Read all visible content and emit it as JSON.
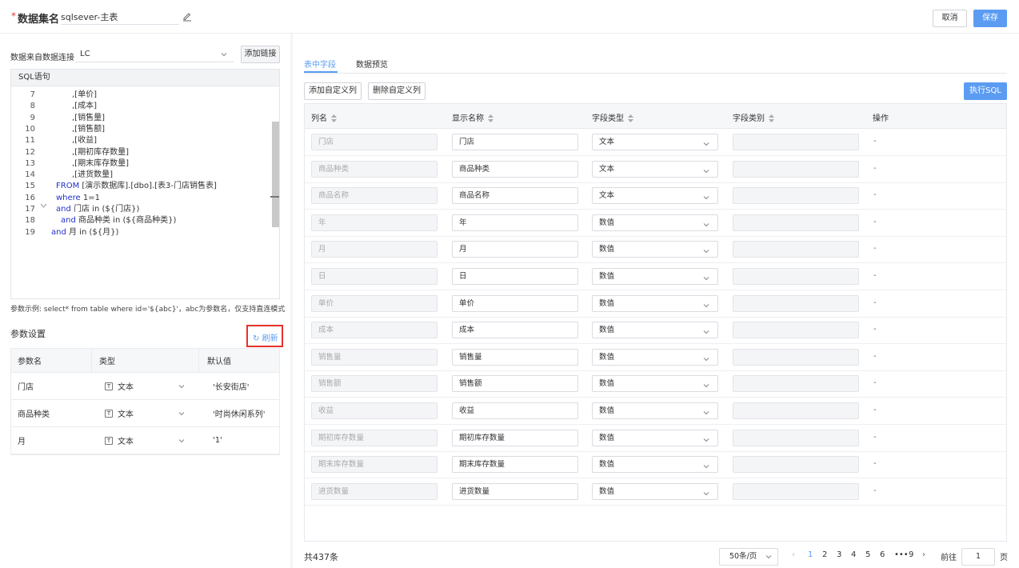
{
  "header": {
    "required_mark": "*",
    "title": "数据集名",
    "dataset_name": "sqlsever-主表",
    "cancel": "取消",
    "save": "保存"
  },
  "left": {
    "source_label": "数据来自数据连接",
    "source_value": "LC",
    "add_link": "添加链接",
    "sql_title": "SQL语句",
    "sql_lines": [
      {
        "n": "7",
        "t": ",[单价]"
      },
      {
        "n": "8",
        "t": ",[成本]"
      },
      {
        "n": "9",
        "t": ",[销售量]"
      },
      {
        "n": "10",
        "t": ",[销售额]"
      },
      {
        "n": "11",
        "t": ",[收益]"
      },
      {
        "n": "12",
        "t": ",[期初库存数量]"
      },
      {
        "n": "13",
        "t": ",[期末库存数量]"
      },
      {
        "n": "14",
        "t": ",[进货数量]"
      },
      {
        "n": "15",
        "kw": "FROM",
        "t": " [演示数据库].[dbo].[表3-门店销售表]"
      },
      {
        "n": "16",
        "kw": "where",
        "t": " 1=1"
      },
      {
        "n": "17",
        "kw": "and",
        "t": " 门店 in (${门店})"
      },
      {
        "n": "18",
        "kw": "and",
        "t": " 商品种类 in (${商品种类})"
      },
      {
        "n": "19",
        "kw": "and",
        "t": " 月 in (${月})"
      }
    ],
    "hint": "参数示例: select* from table where id='${abc}'，abc为参数名，仅支持直连模式",
    "params_title": "参数设置",
    "refresh": "刷新",
    "param_headers": [
      "参数名",
      "类型",
      "默认值"
    ],
    "params": [
      {
        "name": "门店",
        "type": "文本",
        "default": "'长安街店'"
      },
      {
        "name": "商品种类",
        "type": "文本",
        "default": "'时尚休闲系列'"
      },
      {
        "name": "月",
        "type": "文本",
        "default": "'1'"
      }
    ]
  },
  "right": {
    "tabs": [
      "表中字段",
      "数据预览"
    ],
    "add_col": "添加自定义列",
    "del_col": "删除自定义列",
    "run_sql": "执行SQL",
    "headers": [
      "列名",
      "显示名称",
      "字段类型",
      "字段类别",
      "操作"
    ],
    "rows": [
      {
        "col": "门店",
        "display": "门店",
        "type": "文本",
        "op": "-"
      },
      {
        "col": "商品种类",
        "display": "商品种类",
        "type": "文本",
        "op": "-"
      },
      {
        "col": "商品名称",
        "display": "商品名称",
        "type": "文本",
        "op": "-"
      },
      {
        "col": "年",
        "display": "年",
        "type": "数值",
        "op": "-"
      },
      {
        "col": "月",
        "display": "月",
        "type": "数值",
        "op": "-"
      },
      {
        "col": "日",
        "display": "日",
        "type": "数值",
        "op": "-"
      },
      {
        "col": "单价",
        "display": "单价",
        "type": "数值",
        "op": "-"
      },
      {
        "col": "成本",
        "display": "成本",
        "type": "数值",
        "op": "-"
      },
      {
        "col": "销售量",
        "display": "销售量",
        "type": "数值",
        "op": "-"
      },
      {
        "col": "销售额",
        "display": "销售额",
        "type": "数值",
        "op": "-"
      },
      {
        "col": "收益",
        "display": "收益",
        "type": "数值",
        "op": "-"
      },
      {
        "col": "期初库存数量",
        "display": "期初库存数量",
        "type": "数值",
        "op": "-"
      },
      {
        "col": "期末库存数量",
        "display": "期末库存数量",
        "type": "数值",
        "op": "-"
      },
      {
        "col": "进货数量",
        "display": "进货数量",
        "type": "数值",
        "op": "-"
      }
    ],
    "pager": {
      "total": "共437条",
      "page_size": "50条/页",
      "pages": [
        "1",
        "2",
        "3",
        "4",
        "5",
        "6",
        "•••",
        "9"
      ],
      "goto": "前往",
      "goto_value": "1",
      "page_unit": "页"
    }
  },
  "colors": {
    "accent": "#5b9cf2",
    "highlight_border": "#e5322d",
    "keyword": "#2330c9"
  }
}
